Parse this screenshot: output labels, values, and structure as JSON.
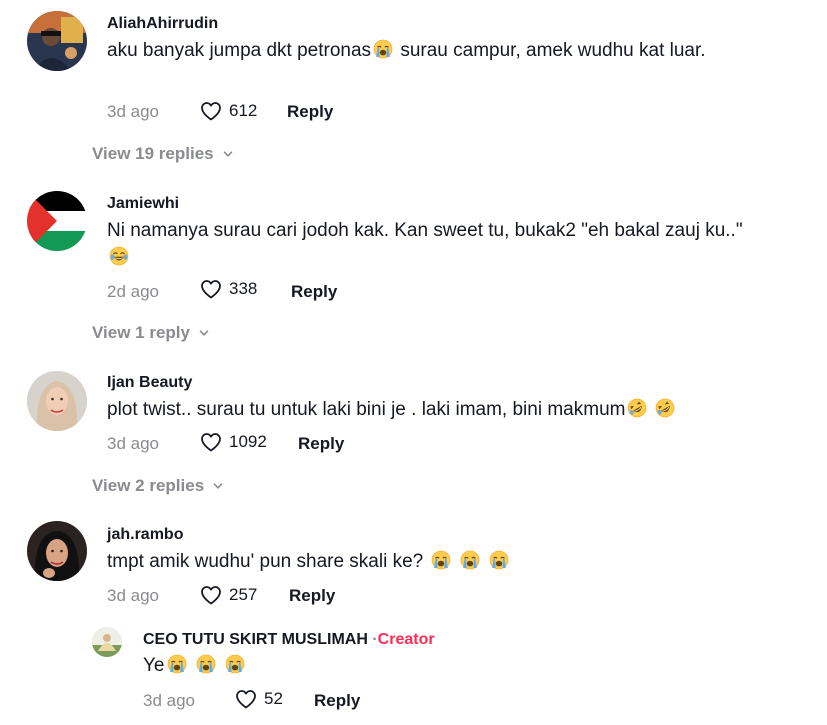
{
  "comments": [
    {
      "username": "AliahAhirrudin",
      "text_before": "aku banyak jumpa dkt petronas",
      "text_after": " surau campur, amek wudhu kat luar.",
      "time": "3d ago",
      "likes": "612",
      "reply_label": "Reply",
      "view_replies": "View 19 replies"
    },
    {
      "username": "Jamiewhi",
      "text_before": "Ni namanya surau cari jodoh kak. Kan sweet tu, bukak2 \"eh bakal zauj ku..\"",
      "time": "2d ago",
      "likes": "338",
      "reply_label": "Reply",
      "view_replies": "View 1 reply"
    },
    {
      "username": "Ijan Beauty",
      "text_before": "plot twist.. surau tu untuk laki bini je . laki imam, bini makmum",
      "time": "3d ago",
      "likes": "1092",
      "reply_label": "Reply",
      "view_replies": "View 2 replies"
    },
    {
      "username": "jah.rambo",
      "text_before": "tmpt amik wudhu' pun share skali ke?",
      "time": "3d ago",
      "likes": "257",
      "reply_label": "Reply"
    }
  ],
  "nested_reply": {
    "username": "CEO TUTU SKIRT MUSLIMAH",
    "separator": "·",
    "creator_label": "Creator",
    "text_before": "Ye",
    "time": "3d ago",
    "likes": "52",
    "reply_label": "Reply"
  },
  "icons": {
    "like": "heart-outline-icon",
    "expand": "chevron-down-icon",
    "emoji_cry": "loudly-crying-face-emoji",
    "emoji_laugh": "tears-of-joy-emoji",
    "emoji_rofl": "rolling-on-floor-laughing-emoji"
  },
  "colors": {
    "text": "#161823",
    "muted": "#8a8b91",
    "creator": "#fe2c55"
  }
}
